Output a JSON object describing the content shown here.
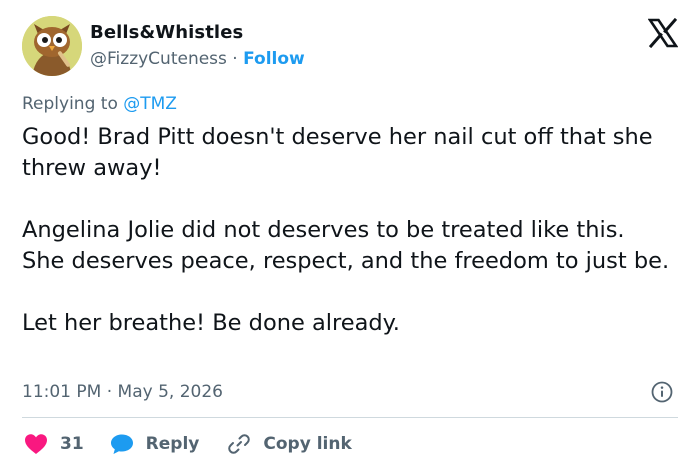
{
  "user": {
    "display_name": "Bells&Whistles",
    "handle": "@FizzyCuteness",
    "separator": "·",
    "follow_label": "Follow"
  },
  "reply_context": {
    "prefix": "Replying to",
    "mention": "@TMZ"
  },
  "post": {
    "paragraphs": [
      "Good! Brad Pitt doesn't deserve her nail cut off that she threw away!",
      "Angelina Jolie did not deserves to be treated like this. She deserves peace, respect, and the freedom to just be.",
      "Let her breathe! Be done already."
    ]
  },
  "meta": {
    "time": "11:01 PM",
    "separator": "·",
    "date": "May 5, 2026"
  },
  "actions": {
    "like_count": "31",
    "reply_label": "Reply",
    "copy_label": "Copy link"
  },
  "icons": {
    "brand": "x-logo-icon",
    "info": "info-icon",
    "like": "heart-icon",
    "reply": "speech-bubble-icon",
    "copy": "link-icon"
  },
  "colors": {
    "accent": "#1d9bf0",
    "like": "#f91880",
    "text": "#0f1419",
    "muted": "#536471",
    "divider": "#cfd9de"
  }
}
